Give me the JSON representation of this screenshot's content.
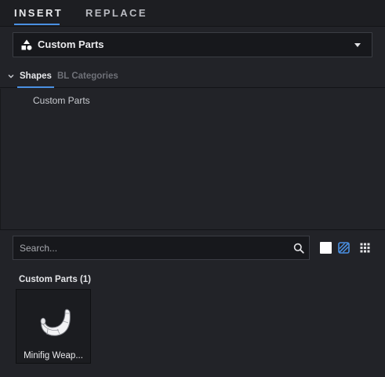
{
  "tabs": [
    {
      "label": "INSERT",
      "active": true
    },
    {
      "label": "REPLACE",
      "active": false
    }
  ],
  "dropdown": {
    "selected": "Custom Parts",
    "icon": "shapes-icon"
  },
  "subtabs": [
    {
      "label": "Shapes",
      "active": true
    },
    {
      "label": "BL Categories",
      "active": false
    }
  ],
  "categories": [
    {
      "label": "Custom Parts"
    }
  ],
  "search": {
    "placeholder": "Search...",
    "value": ""
  },
  "view_buttons": [
    {
      "name": "white-color-swatch",
      "color": "#ffffff"
    },
    {
      "name": "mask-icon",
      "color": "#4a90e2"
    },
    {
      "name": "grid-view-icon",
      "color": "#e3e3e6"
    }
  ],
  "results": {
    "title": "Custom Parts (1)",
    "items": [
      {
        "label": "Minifig Weap...",
        "icon": "horn-part-icon"
      }
    ]
  },
  "colors": {
    "accent": "#4a90e2",
    "background": "#222328"
  }
}
